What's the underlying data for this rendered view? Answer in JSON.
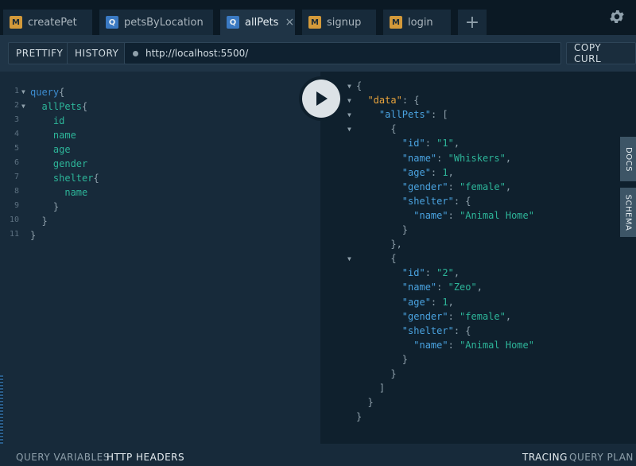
{
  "tabs": [
    {
      "badge": "M",
      "label": "createPet",
      "active": false
    },
    {
      "badge": "Q",
      "label": "petsByLocation",
      "active": false
    },
    {
      "badge": "Q",
      "label": "allPets",
      "active": true,
      "close": "×"
    },
    {
      "badge": "M",
      "label": "signup",
      "active": false
    },
    {
      "badge": "M",
      "label": "login",
      "active": false
    }
  ],
  "add_tab": "+",
  "toolbar": {
    "prettify": "PRETTIFY",
    "history": "HISTORY",
    "url": "http://localhost:5500/",
    "copy_curl": "COPY CURL"
  },
  "query_lines": [
    {
      "n": "1",
      "parts": [
        [
          "kw",
          "query"
        ],
        [
          "br",
          "{"
        ]
      ]
    },
    {
      "n": "2",
      "parts": [
        [
          "fld",
          "  allPets"
        ],
        [
          "br",
          "{"
        ]
      ]
    },
    {
      "n": "3",
      "parts": [
        [
          "fld",
          "    id"
        ]
      ]
    },
    {
      "n": "4",
      "parts": [
        [
          "fld",
          "    name"
        ]
      ]
    },
    {
      "n": "5",
      "parts": [
        [
          "fld",
          "    age"
        ]
      ]
    },
    {
      "n": "6",
      "parts": [
        [
          "fld",
          "    gender"
        ]
      ]
    },
    {
      "n": "7",
      "parts": [
        [
          "fld",
          "    shelter"
        ],
        [
          "br",
          "{"
        ]
      ]
    },
    {
      "n": "8",
      "parts": [
        [
          "fld",
          "      name"
        ]
      ]
    },
    {
      "n": "9",
      "parts": [
        [
          "br",
          "    }"
        ]
      ]
    },
    {
      "n": "10",
      "parts": [
        [
          "br",
          "  }"
        ]
      ]
    },
    {
      "n": "11",
      "parts": [
        [
          "br",
          "}"
        ]
      ]
    }
  ],
  "result_lines": [
    [
      [
        "br",
        "{"
      ]
    ],
    [
      [
        "br",
        "  "
      ],
      [
        "dk",
        "\"data\""
      ],
      [
        "br",
        ": {"
      ]
    ],
    [
      [
        "br",
        "    "
      ],
      [
        "key",
        "\"allPets\""
      ],
      [
        "br",
        ": ["
      ]
    ],
    [
      [
        "br",
        "      {"
      ]
    ],
    [
      [
        "br",
        "        "
      ],
      [
        "key",
        "\"id\""
      ],
      [
        "br",
        ": "
      ],
      [
        "str",
        "\"1\""
      ],
      [
        "br",
        ","
      ]
    ],
    [
      [
        "br",
        "        "
      ],
      [
        "key",
        "\"name\""
      ],
      [
        "br",
        ": "
      ],
      [
        "str",
        "\"Whiskers\""
      ],
      [
        "br",
        ","
      ]
    ],
    [
      [
        "br",
        "        "
      ],
      [
        "key",
        "\"age\""
      ],
      [
        "br",
        ": "
      ],
      [
        "num",
        "1"
      ],
      [
        "br",
        ","
      ]
    ],
    [
      [
        "br",
        "        "
      ],
      [
        "key",
        "\"gender\""
      ],
      [
        "br",
        ": "
      ],
      [
        "str",
        "\"female\""
      ],
      [
        "br",
        ","
      ]
    ],
    [
      [
        "br",
        "        "
      ],
      [
        "key",
        "\"shelter\""
      ],
      [
        "br",
        ": {"
      ]
    ],
    [
      [
        "br",
        "          "
      ],
      [
        "key",
        "\"name\""
      ],
      [
        "br",
        ": "
      ],
      [
        "str",
        "\"Animal Home\""
      ]
    ],
    [
      [
        "br",
        "        }"
      ]
    ],
    [
      [
        "br",
        "      },"
      ]
    ],
    [
      [
        "br",
        "      {"
      ]
    ],
    [
      [
        "br",
        "        "
      ],
      [
        "key",
        "\"id\""
      ],
      [
        "br",
        ": "
      ],
      [
        "str",
        "\"2\""
      ],
      [
        "br",
        ","
      ]
    ],
    [
      [
        "br",
        "        "
      ],
      [
        "key",
        "\"name\""
      ],
      [
        "br",
        ": "
      ],
      [
        "str",
        "\"Zeo\""
      ],
      [
        "br",
        ","
      ]
    ],
    [
      [
        "br",
        "        "
      ],
      [
        "key",
        "\"age\""
      ],
      [
        "br",
        ": "
      ],
      [
        "num",
        "1"
      ],
      [
        "br",
        ","
      ]
    ],
    [
      [
        "br",
        "        "
      ],
      [
        "key",
        "\"gender\""
      ],
      [
        "br",
        ": "
      ],
      [
        "str",
        "\"female\""
      ],
      [
        "br",
        ","
      ]
    ],
    [
      [
        "br",
        "        "
      ],
      [
        "key",
        "\"shelter\""
      ],
      [
        "br",
        ": {"
      ]
    ],
    [
      [
        "br",
        "          "
      ],
      [
        "key",
        "\"name\""
      ],
      [
        "br",
        ": "
      ],
      [
        "str",
        "\"Animal Home\""
      ]
    ],
    [
      [
        "br",
        "        }"
      ]
    ],
    [
      [
        "br",
        "      }"
      ]
    ],
    [
      [
        "br",
        "    ]"
      ]
    ],
    [
      [
        "br",
        "  }"
      ]
    ],
    [
      [
        "br",
        "}"
      ]
    ]
  ],
  "side_tabs": {
    "docs": "DOCS",
    "schema": "SCHEMA"
  },
  "bottom": {
    "query_variables": "QUERY VARIABLES",
    "http_headers": "HTTP HEADERS",
    "tracing": "TRACING",
    "query_plan": "QUERY PLAN"
  },
  "colors": {
    "accent": "#3a79c2",
    "mutation": "#d49a3a",
    "string": "#2db599",
    "key": "#4aa3e0",
    "data_key": "#e8a33c"
  },
  "icons": {
    "settings": "gear-icon",
    "run": "play-icon",
    "fold": "fold-arrow-icon"
  }
}
